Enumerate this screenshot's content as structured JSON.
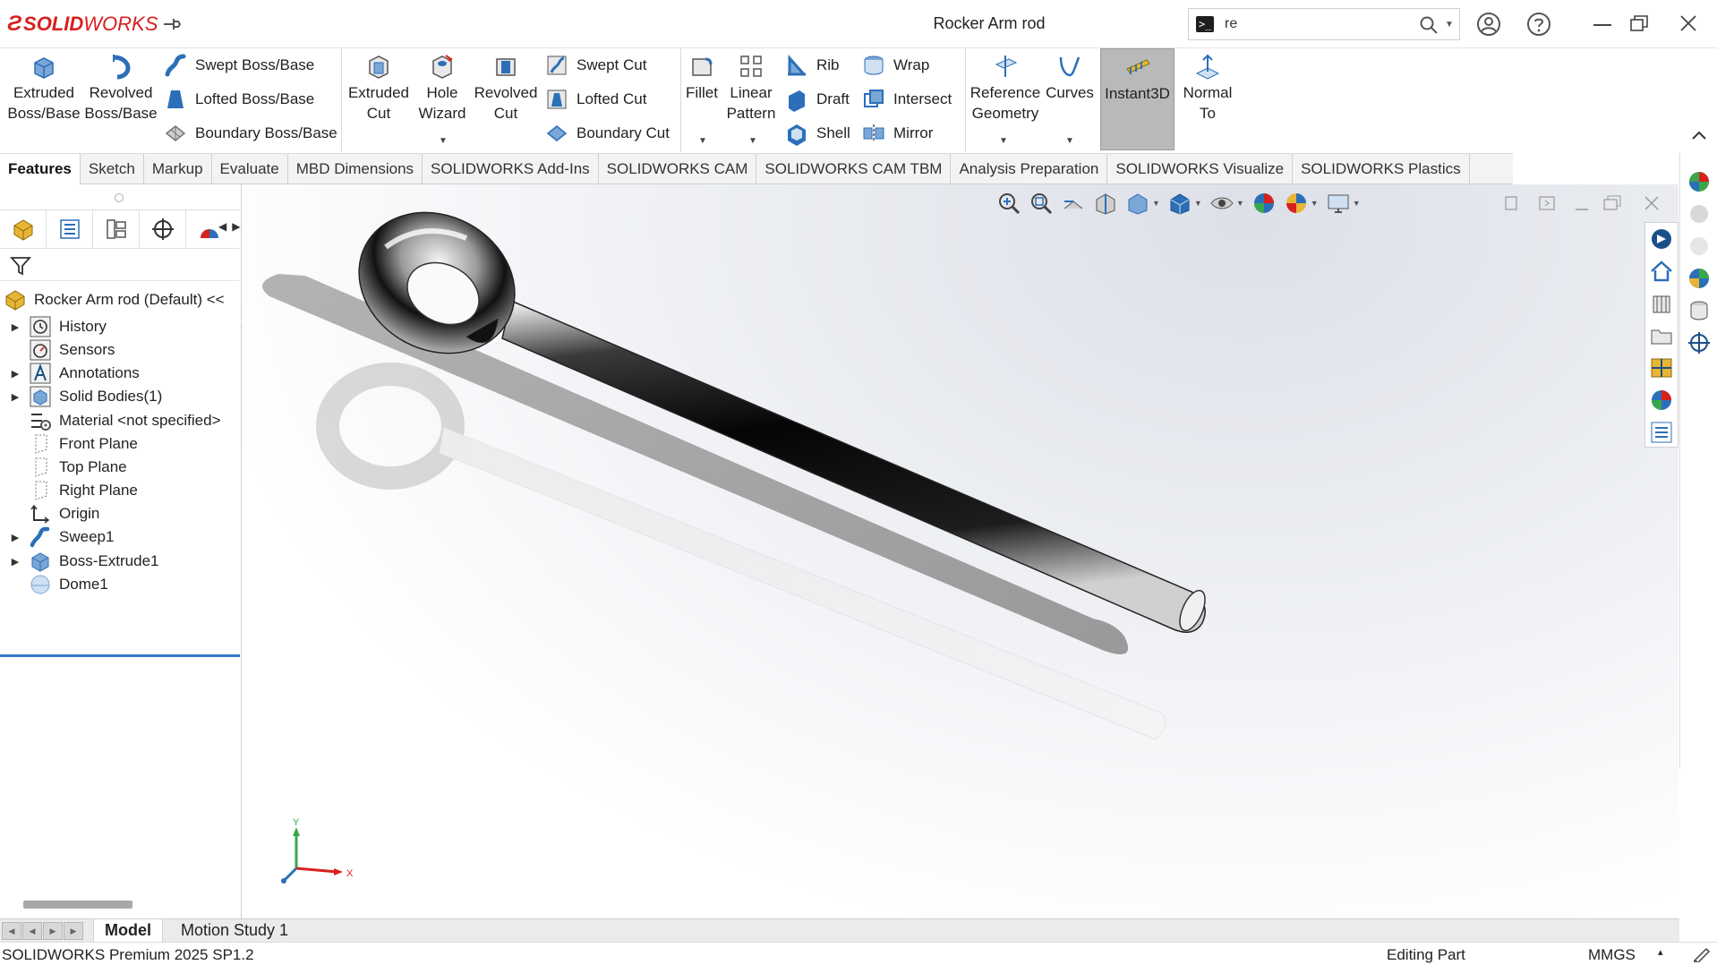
{
  "app": {
    "brand_ds": "Ƨ",
    "brand_solid": "SOLID",
    "brand_works": "WORKS",
    "doc_title": "Rocker Arm rod"
  },
  "search": {
    "value": "re",
    "placeholder": ""
  },
  "colors": {
    "accent_red": "#d6211f",
    "selection_blue": "#2e77c8",
    "icon_blue": "#2b6fb8",
    "icon_yellow": "#e8b634"
  },
  "features_toolbar": {
    "extruded_boss": [
      "Extruded",
      "Boss/Base"
    ],
    "revolved_boss": [
      "Revolved",
      "Boss/Base"
    ],
    "swept_boss": "Swept Boss/Base",
    "lofted_boss": "Lofted Boss/Base",
    "boundary_boss": "Boundary Boss/Base",
    "extruded_cut": [
      "Extruded",
      "Cut"
    ],
    "hole_wizard": [
      "Hole",
      "Wizard"
    ],
    "revolved_cut": [
      "Revolved",
      "Cut"
    ],
    "swept_cut": "Swept Cut",
    "lofted_cut": "Lofted Cut",
    "boundary_cut": "Boundary Cut",
    "fillet": "Fillet",
    "linear_pattern": [
      "Linear",
      "Pattern"
    ],
    "rib": "Rib",
    "draft": "Draft",
    "shell": "Shell",
    "wrap": "Wrap",
    "intersect": "Intersect",
    "mirror": "Mirror",
    "reference_geometry": [
      "Reference",
      "Geometry"
    ],
    "curves": "Curves",
    "instant3d": "Instant3D",
    "normal_to": [
      "Normal",
      "To"
    ]
  },
  "tabs": [
    "Features",
    "Sketch",
    "Markup",
    "Evaluate",
    "MBD Dimensions",
    "SOLIDWORKS Add-Ins",
    "SOLIDWORKS CAM",
    "SOLIDWORKS CAM TBM",
    "Analysis Preparation",
    "SOLIDWORKS Visualize",
    "SOLIDWORKS Plastics"
  ],
  "feature_tree": {
    "root": "Rocker Arm rod  (Default) <<",
    "items": [
      {
        "label": "History",
        "icon": "history-icon",
        "expandable": true
      },
      {
        "label": "Sensors",
        "icon": "sensors-icon",
        "expandable": false
      },
      {
        "label": "Annotations",
        "icon": "annotations-icon",
        "expandable": true
      },
      {
        "label": "Solid Bodies(1)",
        "icon": "solid-bodies-icon",
        "expandable": true
      },
      {
        "label": "Material <not specified>",
        "icon": "material-icon",
        "expandable": false
      },
      {
        "label": "Front Plane",
        "icon": "plane-icon",
        "expandable": false
      },
      {
        "label": "Top Plane",
        "icon": "plane-icon",
        "expandable": false
      },
      {
        "label": "Right Plane",
        "icon": "plane-icon",
        "expandable": false
      },
      {
        "label": "Origin",
        "icon": "origin-icon",
        "expandable": false
      },
      {
        "label": "Sweep1",
        "icon": "sweep-icon",
        "expandable": true
      },
      {
        "label": "Boss-Extrude1",
        "icon": "extrude-icon",
        "expandable": true
      },
      {
        "label": "Dome1",
        "icon": "dome-icon",
        "expandable": false
      }
    ]
  },
  "triad": {
    "x": "X",
    "y": "Y"
  },
  "bottom_tabs": {
    "model": "Model",
    "motion": "Motion Study 1"
  },
  "status": {
    "product": "SOLIDWORKS Premium 2025 SP1.2",
    "mode": "Editing Part",
    "units": "MMGS",
    "caret": "▴"
  }
}
